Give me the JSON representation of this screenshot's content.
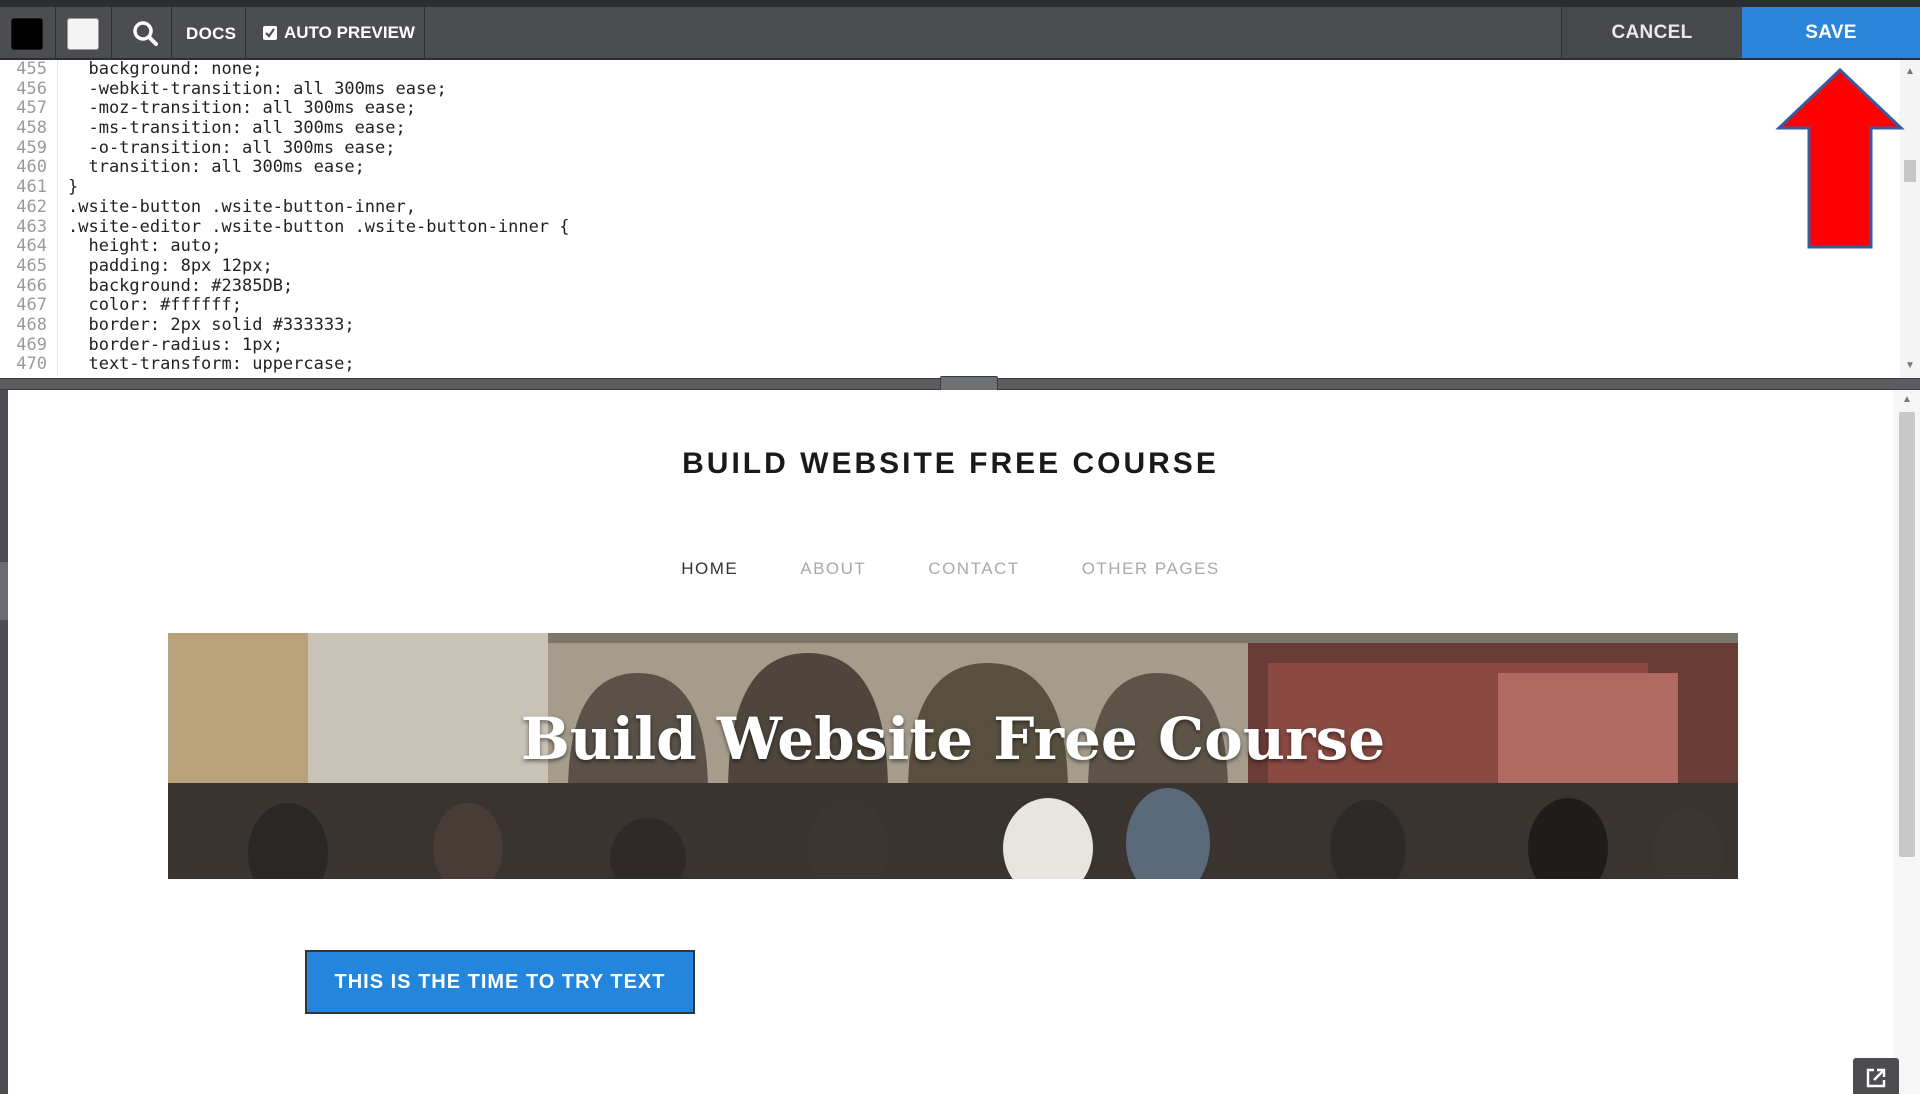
{
  "toolbar": {
    "docs_label": "DOCS",
    "auto_preview_label": "AUTO PREVIEW",
    "auto_preview_checked": true,
    "cancel_label": "CANCEL",
    "save_label": "SAVE"
  },
  "editor": {
    "lines": [
      {
        "n": "455",
        "text": "  background: none;"
      },
      {
        "n": "456",
        "text": "  -webkit-transition: all 300ms ease;"
      },
      {
        "n": "457",
        "text": "  -moz-transition: all 300ms ease;"
      },
      {
        "n": "458",
        "text": "  -ms-transition: all 300ms ease;"
      },
      {
        "n": "459",
        "text": "  -o-transition: all 300ms ease;"
      },
      {
        "n": "460",
        "text": "  transition: all 300ms ease;"
      },
      {
        "n": "461",
        "text": "}"
      },
      {
        "n": "462",
        "text": ".wsite-button .wsite-button-inner,"
      },
      {
        "n": "463",
        "text": ".wsite-editor .wsite-button .wsite-button-inner {"
      },
      {
        "n": "464",
        "text": "  height: auto;"
      },
      {
        "n": "465",
        "text": "  padding: 8px 12px;"
      },
      {
        "n": "466",
        "text": "  background: #2385DB;"
      },
      {
        "n": "467",
        "text": "  color: #ffffff;"
      },
      {
        "n": "468",
        "text": "  border: 2px solid #333333;"
      },
      {
        "n": "469",
        "text": "  border-radius: 1px;"
      },
      {
        "n": "470",
        "text": "  text-transform: uppercase;"
      }
    ]
  },
  "preview": {
    "site_title": "BUILD WEBSITE FREE COURSE",
    "nav": [
      "HOME",
      "ABOUT",
      "CONTACT",
      "OTHER PAGES"
    ],
    "hero_title": "Build Website Free Course",
    "cta_label": "THIS IS THE TIME TO TRY TEXT"
  },
  "colors": {
    "save_blue": "#2b86db",
    "button_blue": "#2385db",
    "annotation_arrow": "#ff0000"
  }
}
